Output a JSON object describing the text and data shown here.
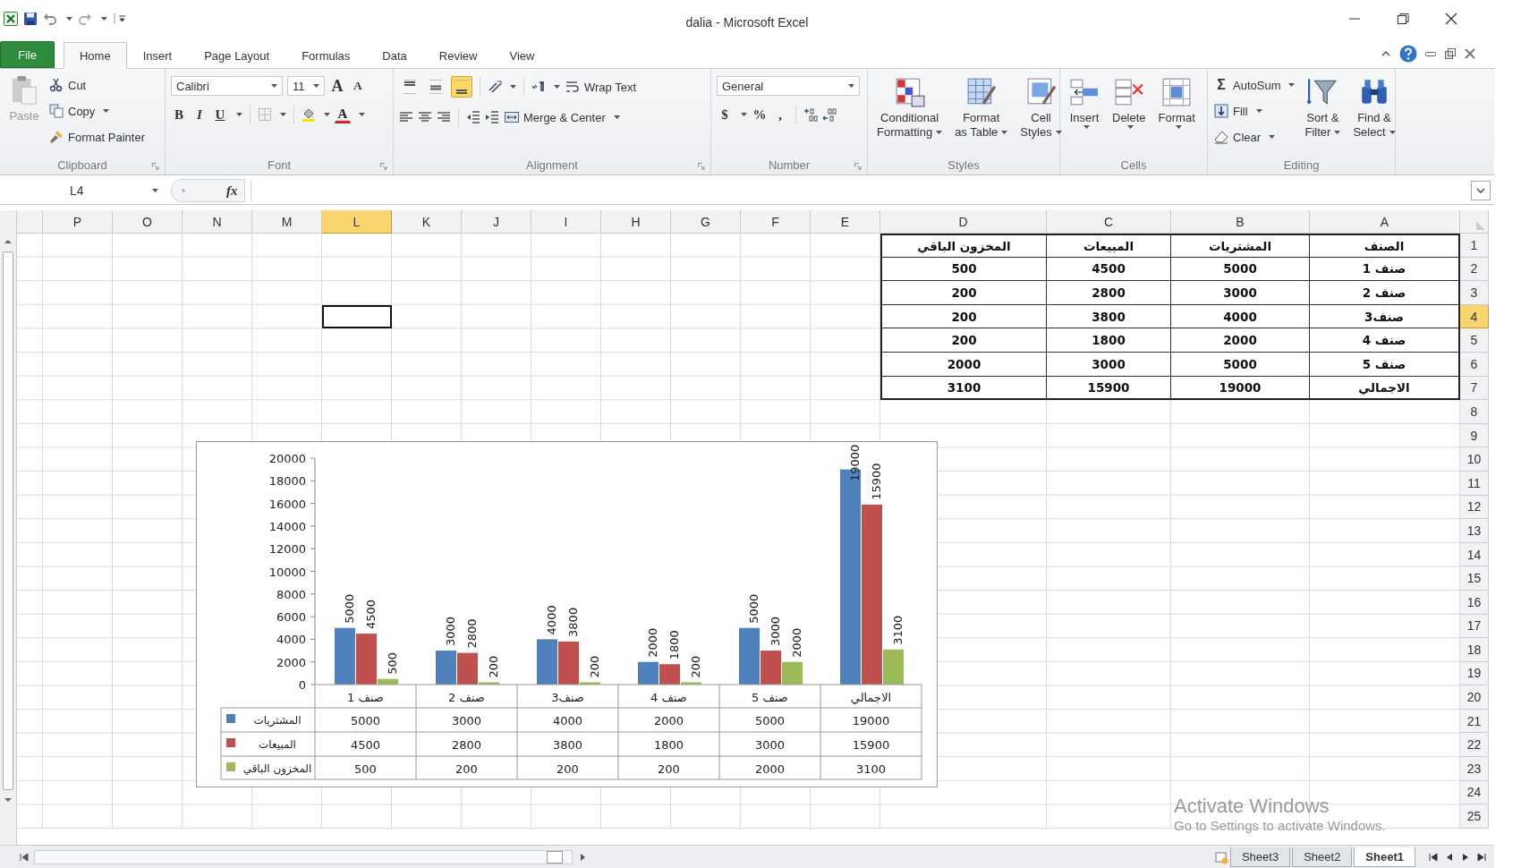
{
  "window": {
    "title": "dalia  -  Microsoft Excel"
  },
  "ribbon_tabs": [
    {
      "label": "File",
      "kind": "file",
      "selected": false
    },
    {
      "label": "Home",
      "kind": "tab",
      "selected": true
    },
    {
      "label": "Insert",
      "kind": "tab",
      "selected": false
    },
    {
      "label": "Page Layout",
      "kind": "tab",
      "selected": false
    },
    {
      "label": "Formulas",
      "kind": "tab",
      "selected": false
    },
    {
      "label": "Data",
      "kind": "tab",
      "selected": false
    },
    {
      "label": "Review",
      "kind": "tab",
      "selected": false
    },
    {
      "label": "View",
      "kind": "tab",
      "selected": false
    }
  ],
  "clipboard": {
    "label": "Clipboard",
    "paste": "Paste",
    "cut": "Cut",
    "copy": "Copy",
    "format_painter": "Format Painter"
  },
  "font": {
    "label": "Font",
    "font_name": "Calibri",
    "font_size": "11",
    "grow": "A",
    "shrink": "A",
    "bold": "B",
    "italic": "I",
    "underline": "U",
    "font_color": "A"
  },
  "alignment": {
    "label": "Alignment",
    "vertical": [
      {
        "selected": false
      },
      {
        "selected": false
      },
      {
        "selected": true
      }
    ],
    "wrap_text": "Wrap Text",
    "merge_center": "Merge & Center"
  },
  "number": {
    "label": "Number",
    "format": "General",
    "currency": "$",
    "percent": "%",
    "comma": ","
  },
  "styles": {
    "label": "Styles",
    "buttons": [
      {
        "lines": [
          "Conditional",
          "Formatting"
        ],
        "kind": "conditional"
      },
      {
        "lines": [
          "Format",
          "as Table"
        ],
        "kind": "table"
      },
      {
        "lines": [
          "Cell",
          "Styles"
        ],
        "kind": "cell"
      }
    ]
  },
  "cells": {
    "label": "Cells",
    "buttons": [
      {
        "label": "Insert",
        "kind": "insert"
      },
      {
        "label": "Delete",
        "kind": "delete"
      },
      {
        "label": "Format",
        "kind": "format"
      }
    ]
  },
  "editing": {
    "label": "Editing",
    "sigma": "Σ",
    "autosum": "AutoSum",
    "fill": "Fill",
    "clear": "Clear",
    "sort": [
      "Sort &",
      "Filter"
    ],
    "find": [
      "Find &",
      "Select"
    ]
  },
  "formula_bar": {
    "name_box": "L4",
    "function_label": "fx"
  },
  "sheet": {
    "columns": [
      {
        "label": "P",
        "selected": false
      },
      {
        "label": "O",
        "selected": false
      },
      {
        "label": "N",
        "selected": false
      },
      {
        "label": "M",
        "selected": false
      },
      {
        "label": "L",
        "selected": true
      },
      {
        "label": "K",
        "selected": false
      },
      {
        "label": "J",
        "selected": false
      },
      {
        "label": "I",
        "selected": false
      },
      {
        "label": "H",
        "selected": false
      },
      {
        "label": "G",
        "selected": false
      },
      {
        "label": "F",
        "selected": false
      },
      {
        "label": "E",
        "selected": false
      },
      {
        "label": "D",
        "selected": false
      },
      {
        "label": "C",
        "selected": false
      },
      {
        "label": "B",
        "selected": false
      },
      {
        "label": "A",
        "selected": false
      }
    ],
    "rows": [
      {
        "label": "1",
        "selected": false
      },
      {
        "label": "2",
        "selected": false
      },
      {
        "label": "3",
        "selected": false
      },
      {
        "label": "4",
        "selected": true
      },
      {
        "label": "5",
        "selected": false
      },
      {
        "label": "6",
        "selected": false
      },
      {
        "label": "7",
        "selected": false
      },
      {
        "label": "8",
        "selected": false
      },
      {
        "label": "9",
        "selected": false
      },
      {
        "label": "10",
        "selected": false
      },
      {
        "label": "11",
        "selected": false
      },
      {
        "label": "12",
        "selected": false
      },
      {
        "label": "13",
        "selected": false
      },
      {
        "label": "14",
        "selected": false
      },
      {
        "label": "15",
        "selected": false
      },
      {
        "label": "16",
        "selected": false
      },
      {
        "label": "17",
        "selected": false
      },
      {
        "label": "18",
        "selected": false
      },
      {
        "label": "19",
        "selected": false
      },
      {
        "label": "20",
        "selected": false
      },
      {
        "label": "21",
        "selected": false
      },
      {
        "label": "22",
        "selected": false
      },
      {
        "label": "23",
        "selected": false
      },
      {
        "label": "24",
        "selected": false
      },
      {
        "label": "25",
        "selected": false
      }
    ],
    "table": {
      "rows": [
        [
          "المخزون الباقي",
          "المبيعات",
          "المشتريات",
          "الصنف"
        ],
        [
          "500",
          "4500",
          "5000",
          "صنف 1"
        ],
        [
          "200",
          "2800",
          "3000",
          "صنف 2"
        ],
        [
          "200",
          "3800",
          "4000",
          "صنف3"
        ],
        [
          "200",
          "1800",
          "2000",
          "صنف 4"
        ],
        [
          "2000",
          "3000",
          "5000",
          "صنف 5"
        ],
        [
          "3100",
          "15900",
          "19000",
          "الاجمالي"
        ]
      ]
    }
  },
  "chart": {
    "chart_data": {
      "type": "bar",
      "categories": [
        "صنف 1",
        "صنف 2",
        "صنف3",
        "صنف 4",
        "صنف 5",
        "الاجمالي"
      ],
      "series": [
        {
          "name": "المشتريات",
          "color": "#4f81bd",
          "values": [
            5000,
            3000,
            4000,
            2000,
            5000,
            19000
          ]
        },
        {
          "name": "المبيعات",
          "color": "#c0504d",
          "values": [
            4500,
            2800,
            3800,
            1800,
            3000,
            15900
          ]
        },
        {
          "name": "المخزون الباقي",
          "color": "#9bbb59",
          "values": [
            500,
            200,
            200,
            200,
            2000,
            3100
          ]
        }
      ],
      "ylim": [
        0,
        20000
      ],
      "yticks": [
        0,
        2000,
        4000,
        6000,
        8000,
        10000,
        12000,
        14000,
        16000,
        18000,
        20000
      ],
      "legend": "bottom_left",
      "data_labels": true,
      "value_labels": [
        [
          "5000",
          "3000",
          "4000",
          "2000",
          "5000",
          "19000"
        ],
        [
          "4500",
          "2800",
          "3800",
          "1800",
          "3000",
          "15900"
        ],
        [
          "500",
          "200",
          "200",
          "200",
          "2000",
          "3100"
        ]
      ]
    },
    "data_table": [
      {
        "values": [
          "5000",
          "3000",
          "4000",
          "2000",
          "5000",
          "19000"
        ]
      },
      {
        "values": [
          "4500",
          "2800",
          "3800",
          "1800",
          "3000",
          "15900"
        ]
      },
      {
        "values": [
          "500",
          "200",
          "200",
          "200",
          "2000",
          "3100"
        ]
      }
    ]
  },
  "sheet_tabs": [
    {
      "label": "Sheet3",
      "selected": false
    },
    {
      "label": "Sheet2",
      "selected": false
    },
    {
      "label": "Sheet1",
      "selected": true
    }
  ],
  "activation_notice": {
    "title": "Activate Windows",
    "message": "Go to Settings to activate Windows."
  }
}
